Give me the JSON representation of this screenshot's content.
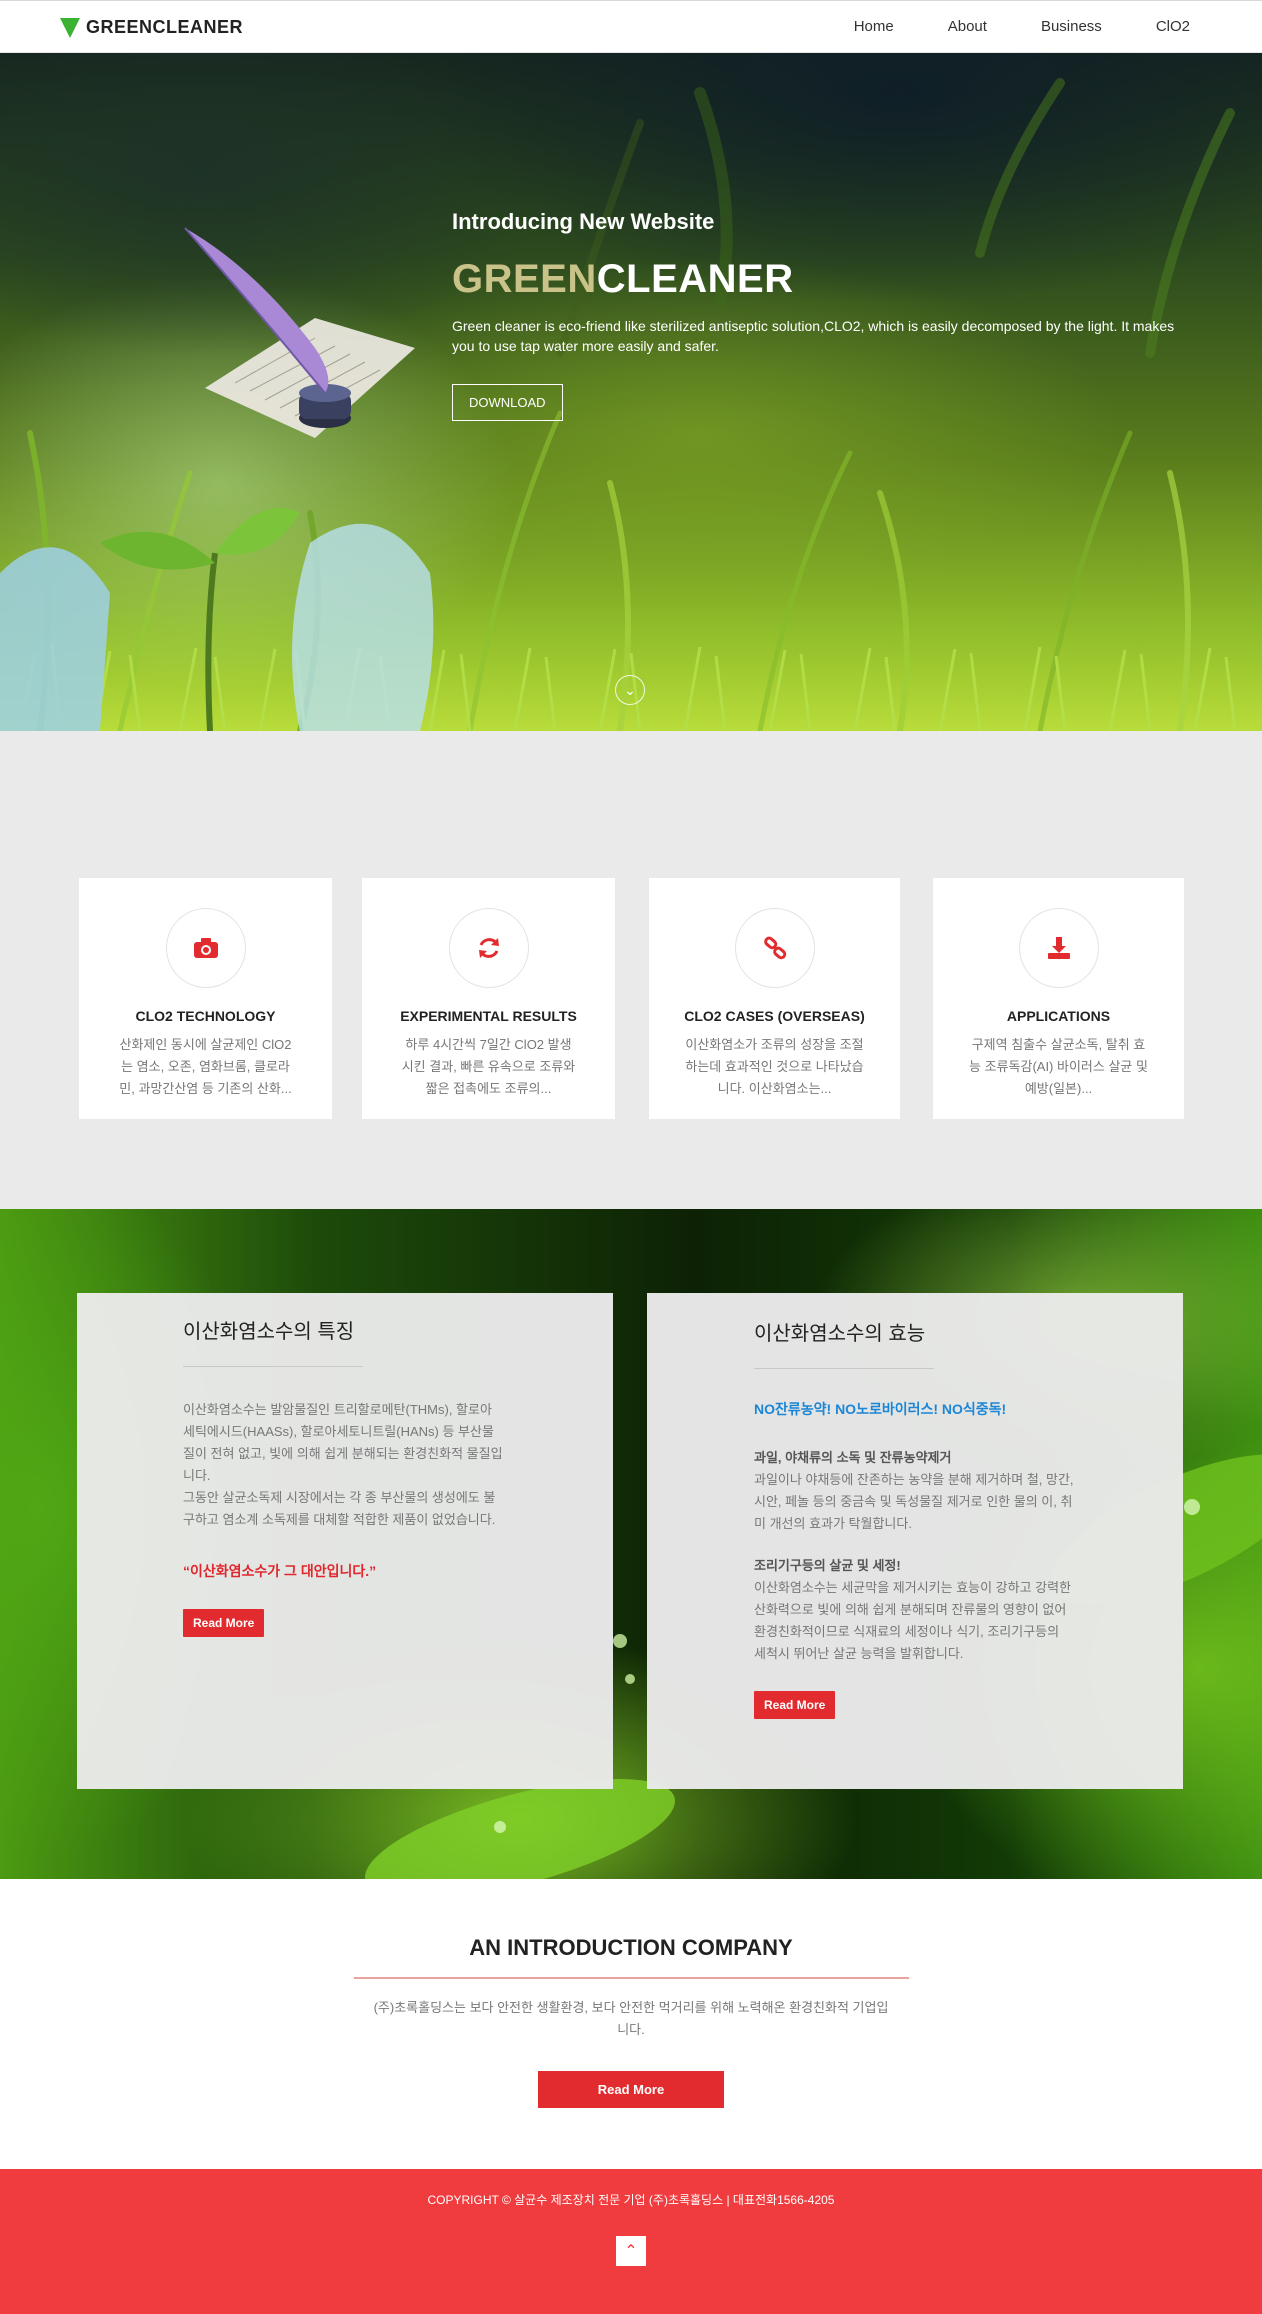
{
  "nav": {
    "logo": "GREENCLEANER",
    "items": [
      "Home",
      "About",
      "Business",
      "ClO2"
    ]
  },
  "hero": {
    "intro": "Introducing New Website",
    "title_green": "GREEN",
    "title_white": "CLEANER",
    "description": "Green cleaner is eco-friend like sterilized antiseptic solution,CLO2, which is easily decomposed by the light. It makes you to use tap water more easily and safer.",
    "button": "DOWNLOAD"
  },
  "services": [
    {
      "icon": "camera-icon",
      "title": "CLO2 TECHNOLOGY",
      "text": "산화제인 동시에 살균제인 ClO2는 염소, 오존, 염화브롬, 클로라민, 과망간산염 등 기존의 산화..."
    },
    {
      "icon": "refresh-icon",
      "title": "EXPERIMENTAL RESULTS",
      "text": "하루 4시간씩 7일간 ClO2 발생 시킨 결과, 빠른 유속으로 조류와 짧은 접촉에도 조류의..."
    },
    {
      "icon": "link-icon",
      "title": "CLO2 CASES (OVERSEAS)",
      "text": "이산화염소가 조류의 성장을 조절하는데 효과적인 것으로 나타났습니다. 이산화염소는..."
    },
    {
      "icon": "download-icon",
      "title": "APPLICATIONS",
      "text": "구제역 침출수 살균소독, 탈취 효능 조류독감(AI) 바이러스 살균 및 예방(일본)..."
    }
  ],
  "features": {
    "left": {
      "title": "이산화염소수의 특징",
      "p1": "이산화염소수는 발암물질인 트리할로메탄(THMs), 할로아세틱에시드(HAASs), 할로아세토니트릴(HANs) 등 부산물질이 전혀 없고, 빛에 의해 쉽게 분해되는 환경친화적 물질입니다.",
      "p2": "그동안 살균소독제 시장에서는 각 종 부산물의 생성에도 불구하고 염소계 소독제를 대체할 적합한 제품이 없었습니다.",
      "quote": "“이산화염소수가 그 대안입니다.”",
      "button": "Read More"
    },
    "right": {
      "title": "이산화염소수의 효능",
      "highlight": "NO잔류농약! NO노로바이러스! NO식중독!",
      "h1": "과일, 야채류의 소독 및 잔류농약제거",
      "t1": "과일이나 야채등에 잔존하는 농약을 분해 제거하며 철, 망간, 시안, 페놀 등의 중금속 및 독성물질 제거로 인한 물의 이, 취미 개선의 효과가 탁월합니다.",
      "h2": "조리기구등의 살균 및 세정!",
      "t2": "이산화염소수는 세균막을 제거시키는 효능이 강하고 강력한 산화력으로 빛에 의해 쉽게 분해되며 잔류물의 영향이 없어 환경친화적이므로 식재료의 세정이나 식기, 조리기구등의 세척시 뛰어난 살균 능력을 발휘합니다.",
      "button": "Read More"
    }
  },
  "intro": {
    "title": "AN INTRODUCTION COMPANY",
    "text": "(주)초록홀딩스는 보다 안전한 생활환경, 보다 안전한 먹거리를 위해 노력해온 환경친화적 기업입니다.",
    "button": "Read More"
  },
  "footer": {
    "copyright": "COPYRIGHT © 살균수 제조장치 전문 기업 (주)초록홀딩스 | 대표전화1566-4205"
  },
  "colors": {
    "accent_red": "#e22b2e",
    "footer_red": "#f03c3f",
    "logo_green": "#3cb233",
    "highlight_blue": "#1b86d6"
  }
}
